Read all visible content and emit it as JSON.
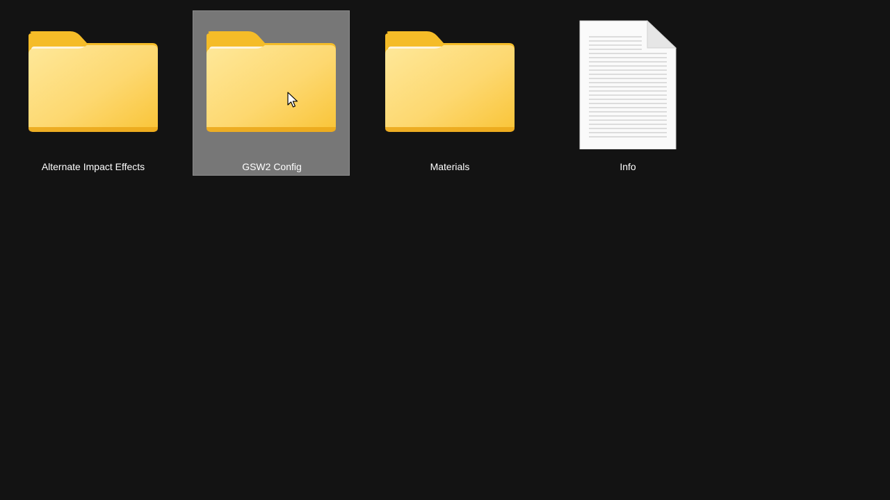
{
  "items": [
    {
      "label": "Alternate Impact Effects",
      "type": "folder",
      "icon": "folder-icon",
      "selected": false
    },
    {
      "label": "GSW2 Config",
      "type": "folder",
      "icon": "folder-icon",
      "selected": true
    },
    {
      "label": "Materials",
      "type": "folder",
      "icon": "folder-icon",
      "selected": false
    },
    {
      "label": "Info",
      "type": "text-document",
      "icon": "document-icon",
      "selected": false
    }
  ],
  "colors": {
    "background": "#131313",
    "selection": "#777777",
    "folder_back": "#F5BE2C",
    "folder_front": "#FDD96B",
    "label": "#FFFFFF"
  }
}
